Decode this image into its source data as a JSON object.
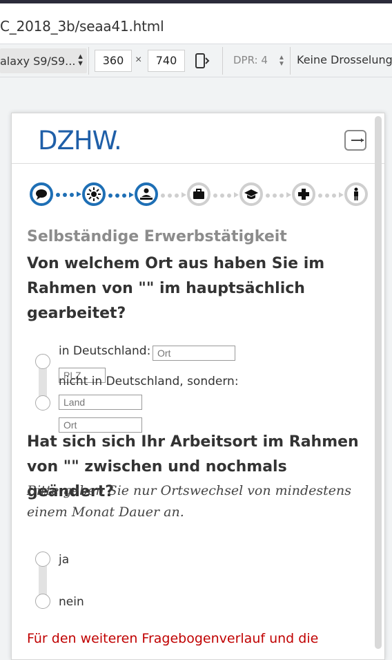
{
  "browser": {
    "url_fragment": "C_2018_3b/seaa41.html",
    "device_name": "alaxy S9/S9...",
    "width": "360",
    "times": "×",
    "height": "740",
    "dpr_label": "DPR: 4",
    "throttle_label": "Keine Drosselung"
  },
  "survey": {
    "logo": "DZHW.",
    "section_title": "Selbständige Erwerbstätigkeit",
    "q1": {
      "text": "Von welchem Ort aus haben Sie im Rahmen von \"\" im hauptsächlich gearbeitet?",
      "option1_label": "in Deutschland:",
      "option1_input_placeholder": "Ort",
      "plz_placeholder": "PLZ",
      "option2_label": "nicht in Deutschland, sondern:",
      "land_placeholder": "Land",
      "ort_placeholder": "Ort"
    },
    "q2": {
      "text": "Hat sich sich Ihr Arbeitsort im Rahmen von \"\" zwischen und nochmals geändert?",
      "hint": "Bitte geben Sie nur Ortswechsel von mindestens einem Monat Dauer an.",
      "option_yes": "ja",
      "option_no": "nein"
    },
    "note": "Für den weiteren Fragebogenverlauf und die",
    "progress": {
      "steps": [
        "speech-bubble-icon",
        "sun-icon",
        "person-at-desk-icon",
        "briefcase-icon",
        "graduation-cap-icon",
        "medical-cross-icon",
        "person-icon"
      ],
      "completed": 3
    },
    "colors": {
      "accent": "#1e6fb5",
      "inactive": "#cfcfcf",
      "note": "#c00000"
    }
  }
}
